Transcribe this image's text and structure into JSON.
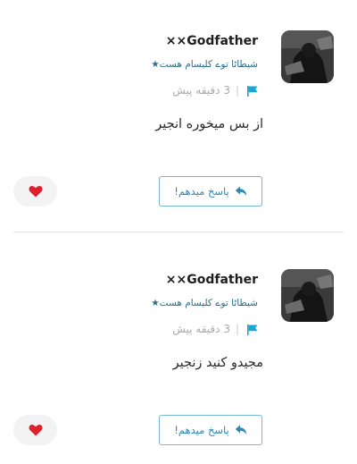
{
  "comments": [
    {
      "username": "××Godfather",
      "tagline": "شیطاٹا توے کلیسام هست★",
      "time": "3 دقیقه پیش",
      "separator": "|",
      "text": "از بس میخوره انجیر",
      "reply_label": "پاسخ میدهم!"
    },
    {
      "username": "××Godfather",
      "tagline": "شیطاٹا توے کلیسام هست★",
      "time": "3 دقیقه پیش",
      "separator": "|",
      "text": "مجیدو کنید زنجیر",
      "reply_label": "پاسخ میدهم!"
    }
  ],
  "colors": {
    "accent": "#2d87b3",
    "flag": "#1aa7d3",
    "heart": "#e0202c",
    "tagline": "#2c6e86"
  },
  "icons": {
    "flag": "flag-icon",
    "reply": "reply-icon",
    "like": "heart-icon"
  }
}
